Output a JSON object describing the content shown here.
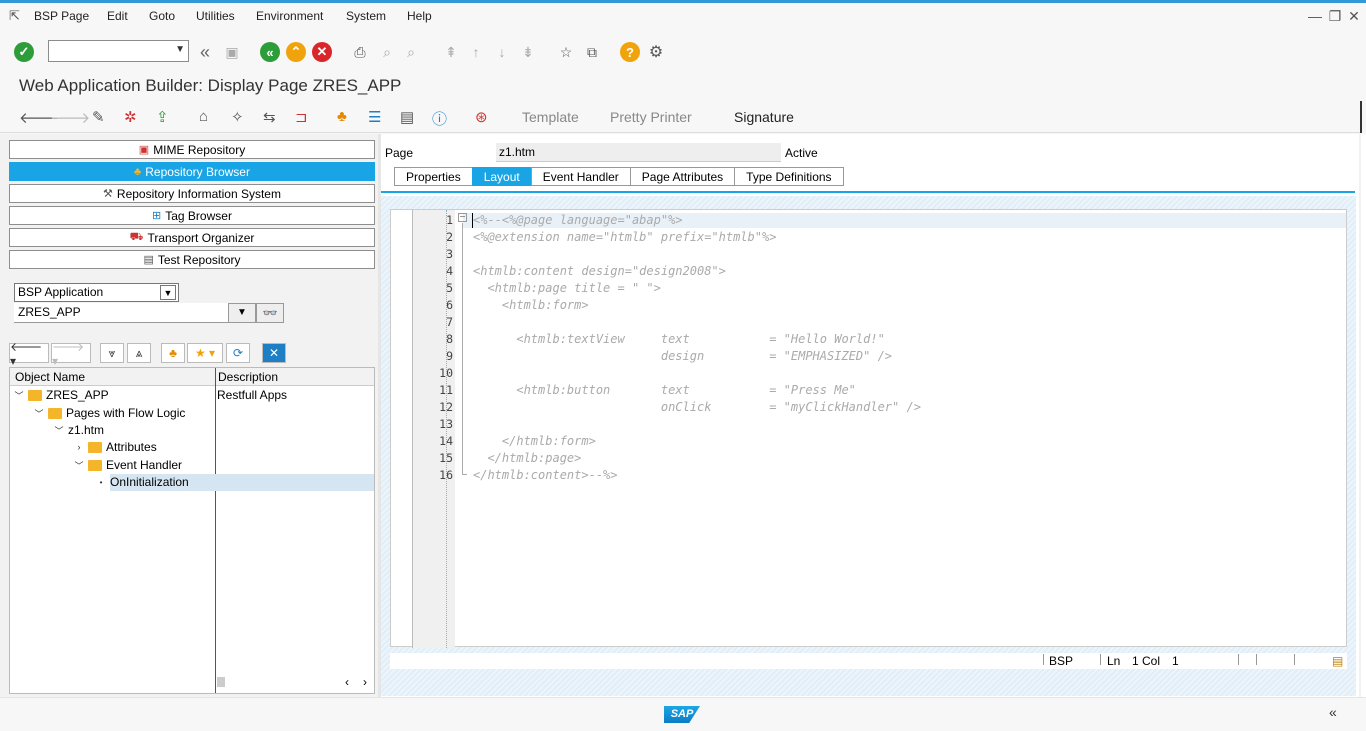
{
  "menu": {
    "items": [
      "BSP Page",
      "Edit",
      "Goto",
      "Utilities",
      "Environment",
      "System",
      "Help"
    ]
  },
  "window": {
    "minimize": "—",
    "restore": "❐",
    "close": "✕"
  },
  "toolbar": {
    "command_value": "",
    "icons": [
      "enter-icon",
      "back-icon",
      "save-icon",
      "back-green-icon",
      "exit-icon",
      "cancel-icon",
      "print-icon",
      "find-icon",
      "find-next-icon",
      "first-page-icon",
      "prev-page-icon",
      "next-page-icon",
      "last-page-icon",
      "create-session-icon",
      "shortcut-icon",
      "help-icon",
      "customize-icon"
    ]
  },
  "title": "Web Application Builder: Display Page ZRES_APP",
  "app_toolbar": {
    "template": "Template",
    "pretty_printer": "Pretty Printer",
    "signature": "Signature"
  },
  "nav": {
    "buttons": [
      "MIME Repository",
      "Repository Browser",
      "Repository Information System",
      "Tag Browser",
      "Transport Organizer",
      "Test Repository"
    ],
    "selected": 1
  },
  "object_selector": {
    "type": "BSP Application",
    "name": "ZRES_APP"
  },
  "tree": {
    "columns": [
      "Object Name",
      "Description"
    ],
    "nodes": [
      {
        "label": "ZRES_APP",
        "desc": "Restfull Apps"
      },
      {
        "label": "Pages with Flow Logic",
        "desc": ""
      },
      {
        "label": "z1.htm",
        "desc": ""
      },
      {
        "label": "Attributes",
        "desc": ""
      },
      {
        "label": "Event Handler",
        "desc": ""
      },
      {
        "label": "OnInitialization",
        "desc": ""
      }
    ]
  },
  "page": {
    "label": "Page",
    "name": "z1.htm",
    "status": "Active"
  },
  "tabs": [
    "Properties",
    "Layout",
    "Event Handler",
    "Page Attributes",
    "Type Definitions"
  ],
  "selected_tab": "Layout",
  "editor": {
    "lines": [
      "<%--<%@page language=\"abap\"%>",
      "<%@extension name=\"htmlb\" prefix=\"htmlb\"%>",
      "",
      "<htmlb:content design=\"design2008\">",
      "  <htmlb:page title = \" \">",
      "    <htmlb:form>",
      "",
      "      <htmlb:textView     text           = \"Hello World!\"",
      "                          design         = \"EMPHASIZED\" />",
      "",
      "      <htmlb:button       text           = \"Press Me\"",
      "                          onClick        = \"myClickHandler\" />",
      "",
      "    </htmlb:form>",
      "  </htmlb:page>",
      "</htmlb:content>--%>"
    ],
    "line_numbers": [
      "1",
      "2",
      "3",
      "4",
      "5",
      "6",
      "7",
      "8",
      "9",
      "10",
      "11",
      "12",
      "13",
      "14",
      "15",
      "16"
    ],
    "status_mode": "BSP",
    "status_ln_label": "Ln",
    "status_ln": "1",
    "status_col_label": "Col",
    "status_col": "1"
  },
  "footer": {
    "logo": "SAP",
    "chevron": "«"
  }
}
